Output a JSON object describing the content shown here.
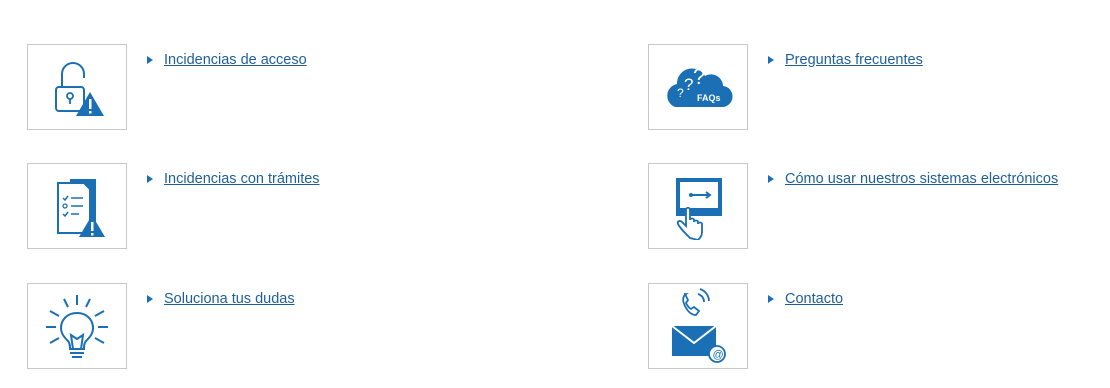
{
  "items": [
    {
      "label": "Incidencias de acceso",
      "icon": "padlock-warning-icon"
    },
    {
      "label": "Preguntas frecuentes",
      "icon": "faqs-cloud-icon"
    },
    {
      "label": "Incidencias con trámites",
      "icon": "document-checklist-warning-icon"
    },
    {
      "label": "Cómo usar nuestros sistemas electrónicos",
      "icon": "hand-touch-screen-icon"
    },
    {
      "label": "Soluciona tus dudas",
      "icon": "lightbulb-icon"
    },
    {
      "label": "Contacto",
      "icon": "phone-mail-icon"
    }
  ],
  "faq_icon_text": "FAQs",
  "colors": {
    "accent": "#1a6fb5",
    "link": "#1f5f99",
    "border": "#c8c8c8"
  }
}
